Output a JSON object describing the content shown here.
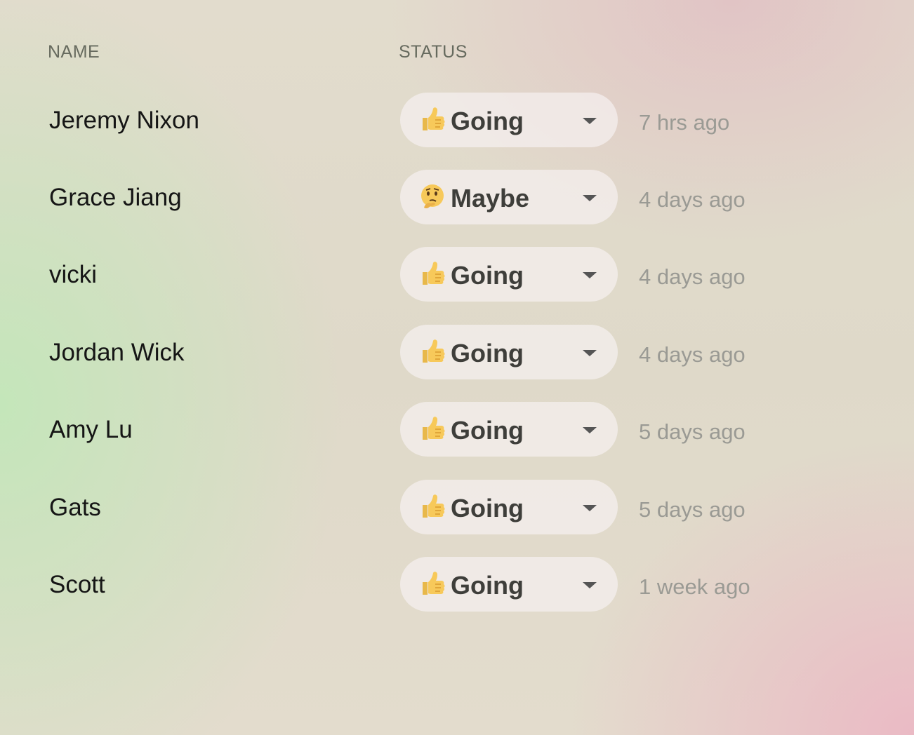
{
  "table": {
    "headers": {
      "name": "NAME",
      "status": "STATUS"
    },
    "rows": [
      {
        "name": "Jeremy Nixon",
        "status": "Going",
        "status_icon": "thumbs-up-icon",
        "time": "7 hrs ago"
      },
      {
        "name": "Grace Jiang",
        "status": "Maybe",
        "status_icon": "thinking-face-icon",
        "time": "4 days ago"
      },
      {
        "name": "vicki",
        "status": "Going",
        "status_icon": "thumbs-up-icon",
        "time": "4 days ago"
      },
      {
        "name": "Jordan Wick",
        "status": "Going",
        "status_icon": "thumbs-up-icon",
        "time": "4 days ago"
      },
      {
        "name": "Amy Lu",
        "status": "Going",
        "status_icon": "thumbs-up-icon",
        "time": "5 days ago"
      },
      {
        "name": "Gats",
        "status": "Going",
        "status_icon": "thumbs-up-icon",
        "time": "5 days ago"
      },
      {
        "name": "Scott",
        "status": "Going",
        "status_icon": "thumbs-up-icon",
        "time": "1 week ago"
      }
    ]
  },
  "colors": {
    "name_text": "#151515",
    "status_text": "#3e3e3a",
    "time_text": "#9a9a94",
    "header_text": "#666a5e",
    "pill_background": "#f5f0f0"
  }
}
